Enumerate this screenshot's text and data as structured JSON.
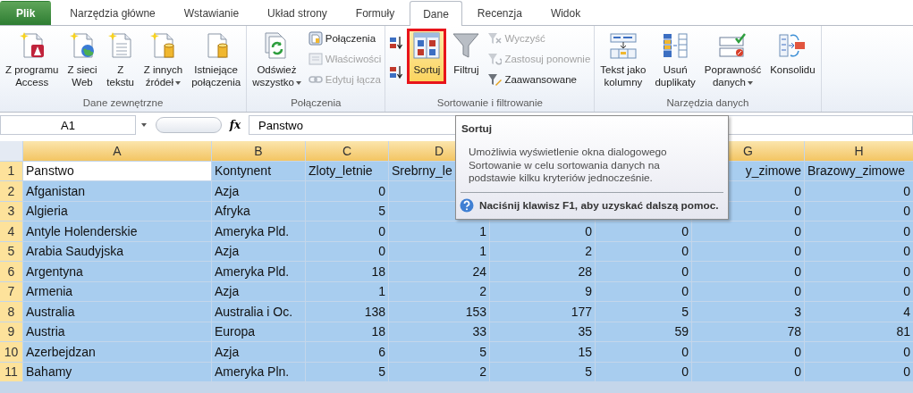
{
  "tabs": [
    {
      "label": "Plik",
      "kind": "file",
      "selected": false
    },
    {
      "label": "Narzędzia główne",
      "kind": "tab",
      "selected": false
    },
    {
      "label": "Wstawianie",
      "kind": "tab",
      "selected": false
    },
    {
      "label": "Układ strony",
      "kind": "tab",
      "selected": false
    },
    {
      "label": "Formuły",
      "kind": "tab",
      "selected": false
    },
    {
      "label": "Dane",
      "kind": "tab",
      "selected": true
    },
    {
      "label": "Recenzja",
      "kind": "tab",
      "selected": false
    },
    {
      "label": "Widok",
      "kind": "tab",
      "selected": false
    }
  ],
  "ribbon": {
    "groups": [
      {
        "label": "Dane zewnętrzne",
        "items": [
          {
            "kind": "large",
            "label": "Z programu\nAccess",
            "dropdown": false
          },
          {
            "kind": "large",
            "label": "Z sieci\nWeb",
            "dropdown": false
          },
          {
            "kind": "large",
            "label": "Z\ntekstu",
            "dropdown": false
          },
          {
            "kind": "large",
            "label": "Z innych\nźródeł",
            "dropdown": true
          },
          {
            "kind": "large",
            "label": "Istniejące\npołączenia",
            "dropdown": false
          }
        ]
      },
      {
        "label": "Połączenia",
        "items": [
          {
            "kind": "large",
            "label": "Odśwież\nwszystko",
            "dropdown": true
          },
          {
            "kind": "small",
            "label": "Połączenia",
            "disabled": false
          },
          {
            "kind": "small",
            "label": "Właściwości",
            "disabled": true
          },
          {
            "kind": "small",
            "label": "Edytuj łącza",
            "disabled": true
          }
        ]
      },
      {
        "label": "Sortowanie i filtrowanie",
        "items": [
          {
            "kind": "icon"
          },
          {
            "kind": "icon"
          },
          {
            "kind": "large",
            "label": "Sortuj",
            "dropdown": false,
            "selected": true
          },
          {
            "kind": "large",
            "label": "Filtruj",
            "dropdown": false,
            "selected": false
          },
          {
            "kind": "small",
            "label": "Wyczyść",
            "disabled": true
          },
          {
            "kind": "small",
            "label": "Zastosuj ponownie",
            "disabled": true
          },
          {
            "kind": "small",
            "label": "Zaawansowane",
            "disabled": false
          }
        ]
      },
      {
        "label": "Narzędzia danych",
        "items": [
          {
            "kind": "large",
            "label": "Tekst jako\nkolumny",
            "dropdown": false
          },
          {
            "kind": "large",
            "label": "Usuń\nduplikaty",
            "dropdown": false
          },
          {
            "kind": "large",
            "label": "Poprawność\ndanych",
            "dropdown": true
          },
          {
            "kind": "large",
            "label": "Konsolidu",
            "dropdown": false
          }
        ]
      }
    ]
  },
  "formula_bar": {
    "name_box": "A1",
    "function_label": "fx",
    "value": "Panstwo"
  },
  "sheet": {
    "selection": true,
    "columns": [
      "A",
      "B",
      "C",
      "D",
      null,
      null,
      "G",
      "H"
    ],
    "rows": [
      {
        "number": "1",
        "cells": [
          {
            "text": "Panstwo",
            "active": true
          },
          "Kontynent",
          "Zloty_letnie",
          "Srebrny_le",
          null,
          null,
          "y_zimowe",
          "Brazowy_zimowe"
        ]
      },
      {
        "number": "2",
        "cells": [
          "Afganistan",
          "Azja",
          "0",
          null,
          null,
          null,
          "0",
          "0"
        ]
      },
      {
        "number": "3",
        "cells": [
          "Algieria",
          "Afryka",
          "5",
          null,
          null,
          null,
          "0",
          "0"
        ]
      },
      {
        "number": "4",
        "cells": [
          "Antyle Holenderskie",
          "Ameryka Pld.",
          "0",
          "1",
          "0",
          "0",
          "0",
          "0"
        ]
      },
      {
        "number": "5",
        "cells": [
          "Arabia Saudyjska",
          "Azja",
          "0",
          "1",
          "2",
          "0",
          "0",
          "0"
        ]
      },
      {
        "number": "6",
        "cells": [
          "Argentyna",
          "Ameryka Pld.",
          "18",
          "24",
          "28",
          "0",
          "0",
          "0"
        ]
      },
      {
        "number": "7",
        "cells": [
          "Armenia",
          "Azja",
          "1",
          "2",
          "9",
          "0",
          "0",
          "0"
        ]
      },
      {
        "number": "8",
        "cells": [
          "Australia",
          "Australia i Oc.",
          "138",
          "153",
          "177",
          "5",
          "3",
          "4"
        ]
      },
      {
        "number": "9",
        "cells": [
          "Austria",
          "Europa",
          "18",
          "33",
          "35",
          "59",
          "78",
          "81"
        ]
      },
      {
        "number": "10",
        "cells": [
          "Azerbejdzan",
          "Azja",
          "6",
          "5",
          "15",
          "0",
          "0",
          "0"
        ]
      },
      {
        "number": "11",
        "cells": [
          "Bahamy",
          "Ameryka Pln.",
          "5",
          "2",
          "5",
          "0",
          "0",
          "0"
        ]
      }
    ]
  },
  "tooltip": {
    "title": "Sortuj",
    "body": "Umożliwia wyświetlenie okna dialogowego\nSortowanie w celu sortowania danych na\npodstawie kilku kryteriów jednocześnie.",
    "help": "Naciśnij klawisz F1, aby uzyskać dalszą pomoc."
  }
}
